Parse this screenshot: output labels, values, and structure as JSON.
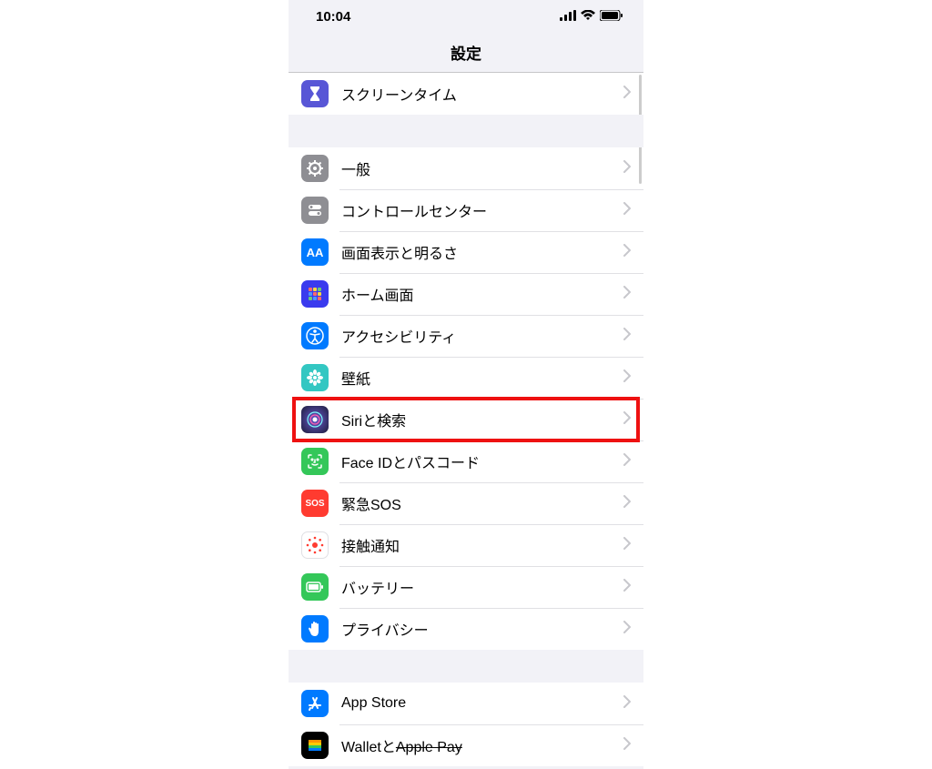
{
  "status": {
    "time": "10:04"
  },
  "header": {
    "title": "設定"
  },
  "rows": {
    "screentime": {
      "label": "スクリーンタイム"
    },
    "general": {
      "label": "一般"
    },
    "control": {
      "label": "コントロールセンター"
    },
    "display": {
      "label": "画面表示と明るさ"
    },
    "home": {
      "label": "ホーム画面"
    },
    "accessibility": {
      "label": "アクセシビリティ"
    },
    "wallpaper": {
      "label": "壁紙"
    },
    "siri": {
      "label": "Siriと検索"
    },
    "faceid": {
      "label": "Face IDとパスコード"
    },
    "sos": {
      "label": "緊急SOS",
      "badge": "SOS"
    },
    "exposure": {
      "label": "接触通知"
    },
    "battery": {
      "label": "バッテリー"
    },
    "privacy": {
      "label": "プライバシー"
    },
    "appstore": {
      "label": "App Store"
    },
    "wallet": {
      "label_prefix": "Walletと",
      "label_strike": "Apple Pay"
    }
  },
  "icons": {
    "display_text": "AA"
  },
  "colors": {
    "screentime": "#5856d6",
    "general": "#8e8e93",
    "control": "#8e8e93",
    "display": "#007aff",
    "home": "#3a3aee",
    "accessibility": "#007aff",
    "wallpaper": "#33c7c2",
    "siri": "#1c1c3a",
    "faceid": "#34c759",
    "sos": "#ff3b30",
    "exposure": "#ffffff",
    "battery": "#34c759",
    "privacy": "#007aff",
    "appstore": "#007aff",
    "wallet": "#000000"
  }
}
